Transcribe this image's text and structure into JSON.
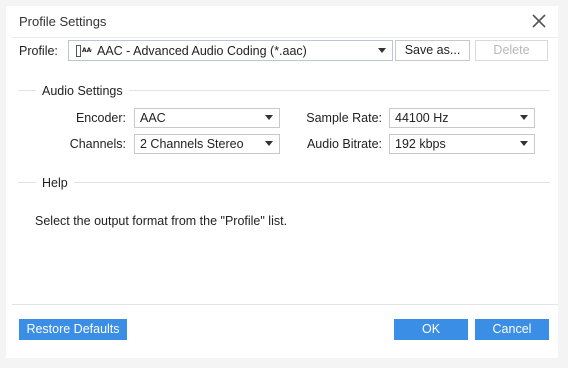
{
  "window": {
    "title": "Profile Settings"
  },
  "profile": {
    "label": "Profile:",
    "value": "AAC - Advanced Audio Coding (*.aac)",
    "icon": "aac-file-icon",
    "save_as_label": "Save as...",
    "delete_label": "Delete"
  },
  "audio_settings": {
    "title": "Audio Settings",
    "encoder": {
      "label": "Encoder:",
      "value": "AAC"
    },
    "channels": {
      "label": "Channels:",
      "value": "2 Channels Stereo"
    },
    "sample_rate": {
      "label": "Sample Rate:",
      "value": "44100 Hz"
    },
    "audio_bitrate": {
      "label": "Audio Bitrate:",
      "value": "192 kbps"
    }
  },
  "help": {
    "title": "Help",
    "text": "Select the output format from the \"Profile\" list."
  },
  "footer": {
    "restore_defaults_label": "Restore Defaults",
    "ok_label": "OK",
    "cancel_label": "Cancel"
  },
  "colors": {
    "accent": "#3a8ee6",
    "border": "#b9c6d6",
    "background": "#ffffff"
  }
}
